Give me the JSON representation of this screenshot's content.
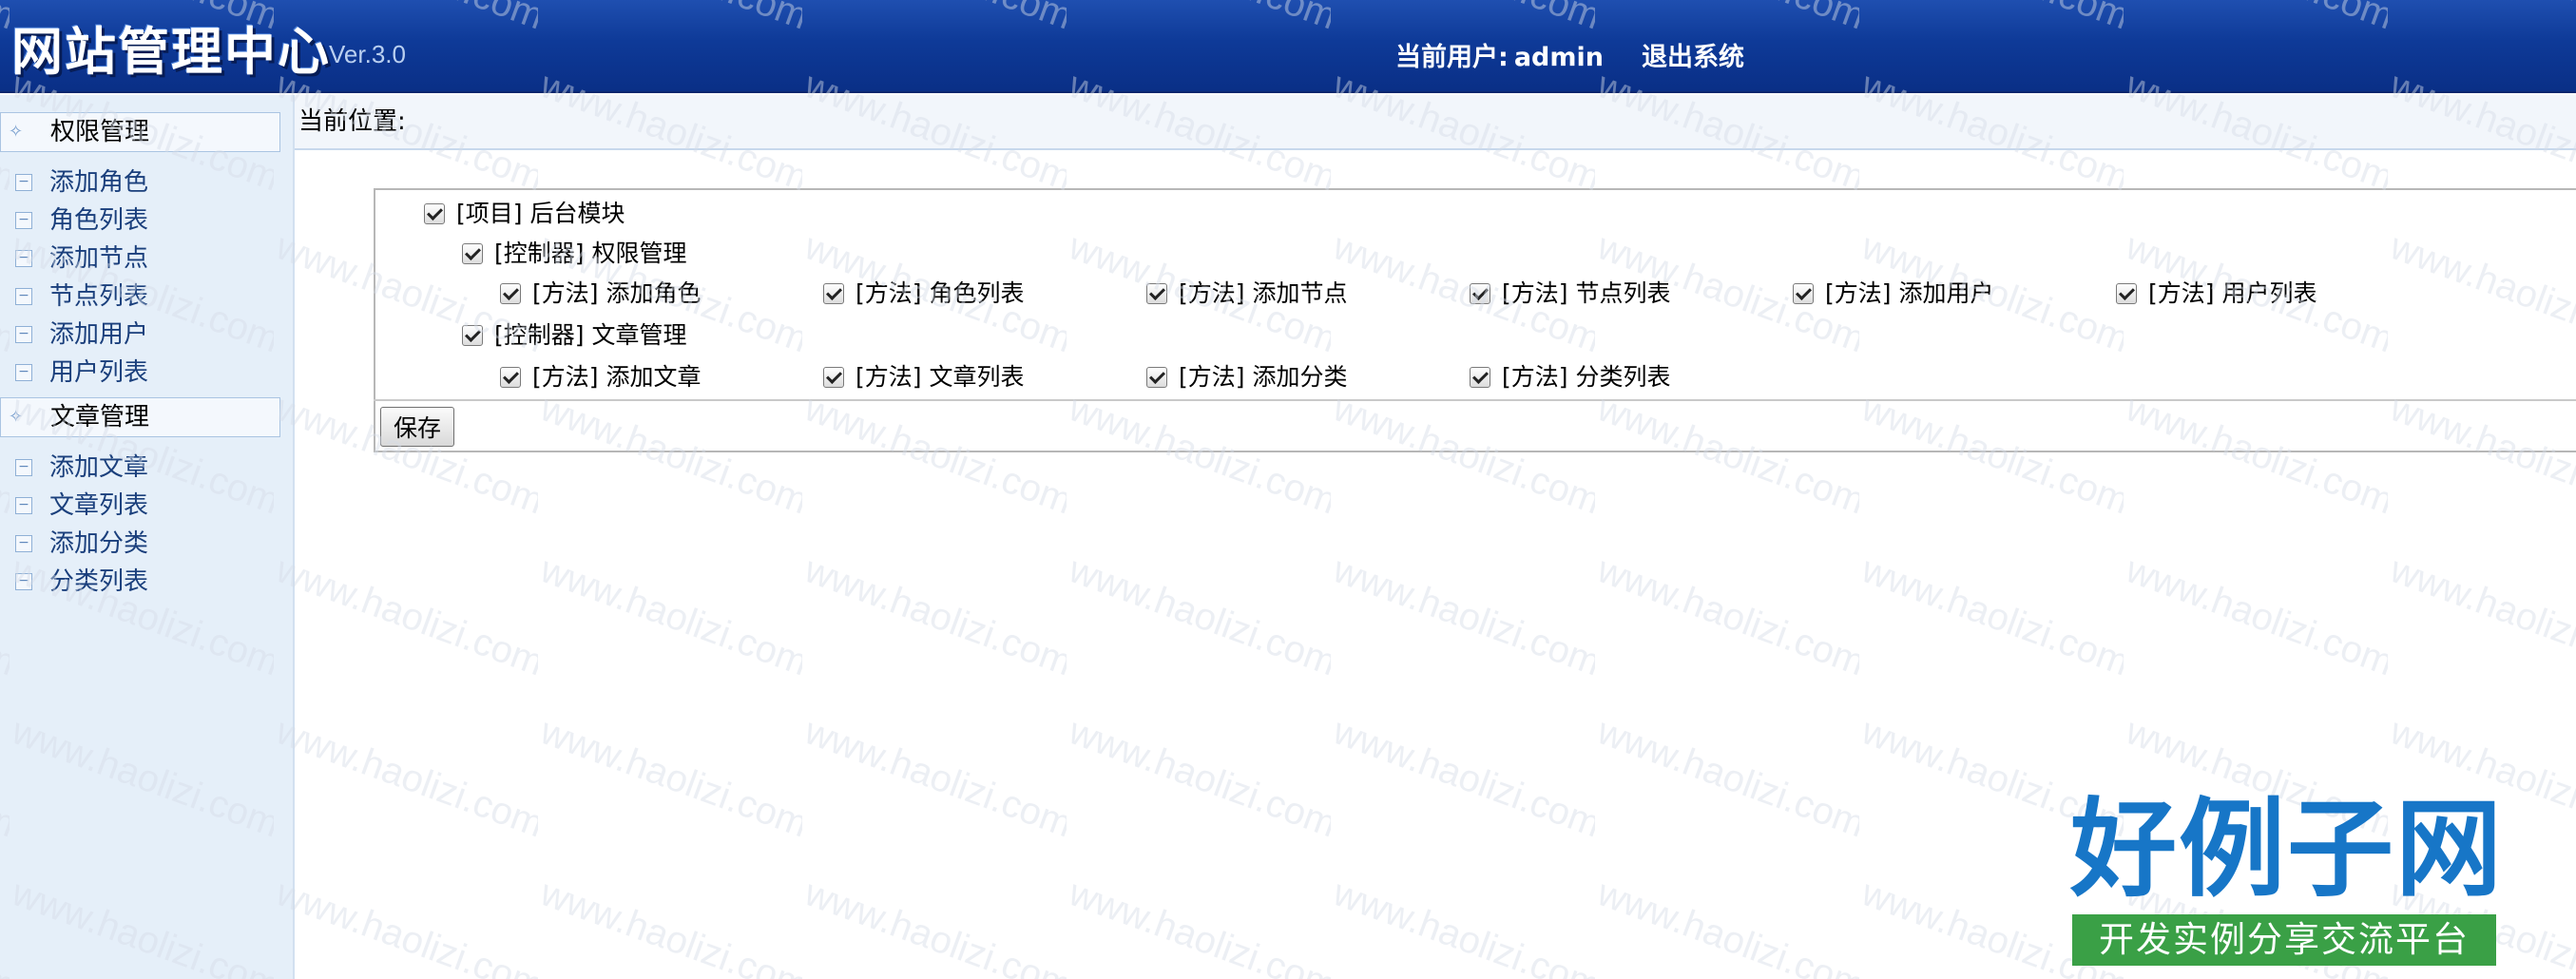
{
  "header": {
    "title": "网站管理中心",
    "version": "Ver.3.0",
    "current_user_label": "当前用户:",
    "username": "admin",
    "logout_label": "退出系统"
  },
  "sidebar": {
    "groups": [
      {
        "label": "权限管理",
        "items": [
          {
            "label": "添加角色"
          },
          {
            "label": "角色列表"
          },
          {
            "label": "添加节点"
          },
          {
            "label": "节点列表"
          },
          {
            "label": "添加用户"
          },
          {
            "label": "用户列表"
          }
        ]
      },
      {
        "label": "文章管理",
        "items": [
          {
            "label": "添加文章"
          },
          {
            "label": "文章列表"
          },
          {
            "label": "添加分类"
          },
          {
            "label": "分类列表"
          }
        ]
      }
    ]
  },
  "breadcrumb": {
    "label": "当前位置:"
  },
  "permissions": {
    "project": {
      "label": "[项目] 后台模块",
      "checked": true
    },
    "controllers": [
      {
        "label": "[控制器] 权限管理",
        "checked": true,
        "methods": [
          {
            "label": "[方法] 添加角色",
            "checked": true
          },
          {
            "label": "[方法] 角色列表",
            "checked": true
          },
          {
            "label": "[方法] 添加节点",
            "checked": true
          },
          {
            "label": "[方法] 节点列表",
            "checked": true
          },
          {
            "label": "[方法] 添加用户",
            "checked": true
          },
          {
            "label": "[方法] 用户列表",
            "checked": true
          }
        ]
      },
      {
        "label": "[控制器] 文章管理",
        "checked": true,
        "methods": [
          {
            "label": "[方法] 添加文章",
            "checked": true
          },
          {
            "label": "[方法] 文章列表",
            "checked": true
          },
          {
            "label": "[方法] 添加分类",
            "checked": true
          },
          {
            "label": "[方法] 分类列表",
            "checked": true
          }
        ]
      }
    ],
    "save_label": "保存"
  },
  "watermark": {
    "text": "www.haolizi.com"
  },
  "logo_stamp": {
    "title": "好例子网",
    "subtitle": "开发实例分享交流平台"
  },
  "colors": {
    "header_bg": "#0e3a98",
    "sidebar_bg": "#e5eff9",
    "stamp_blue": "#1776c7",
    "stamp_green": "#3aa046"
  }
}
